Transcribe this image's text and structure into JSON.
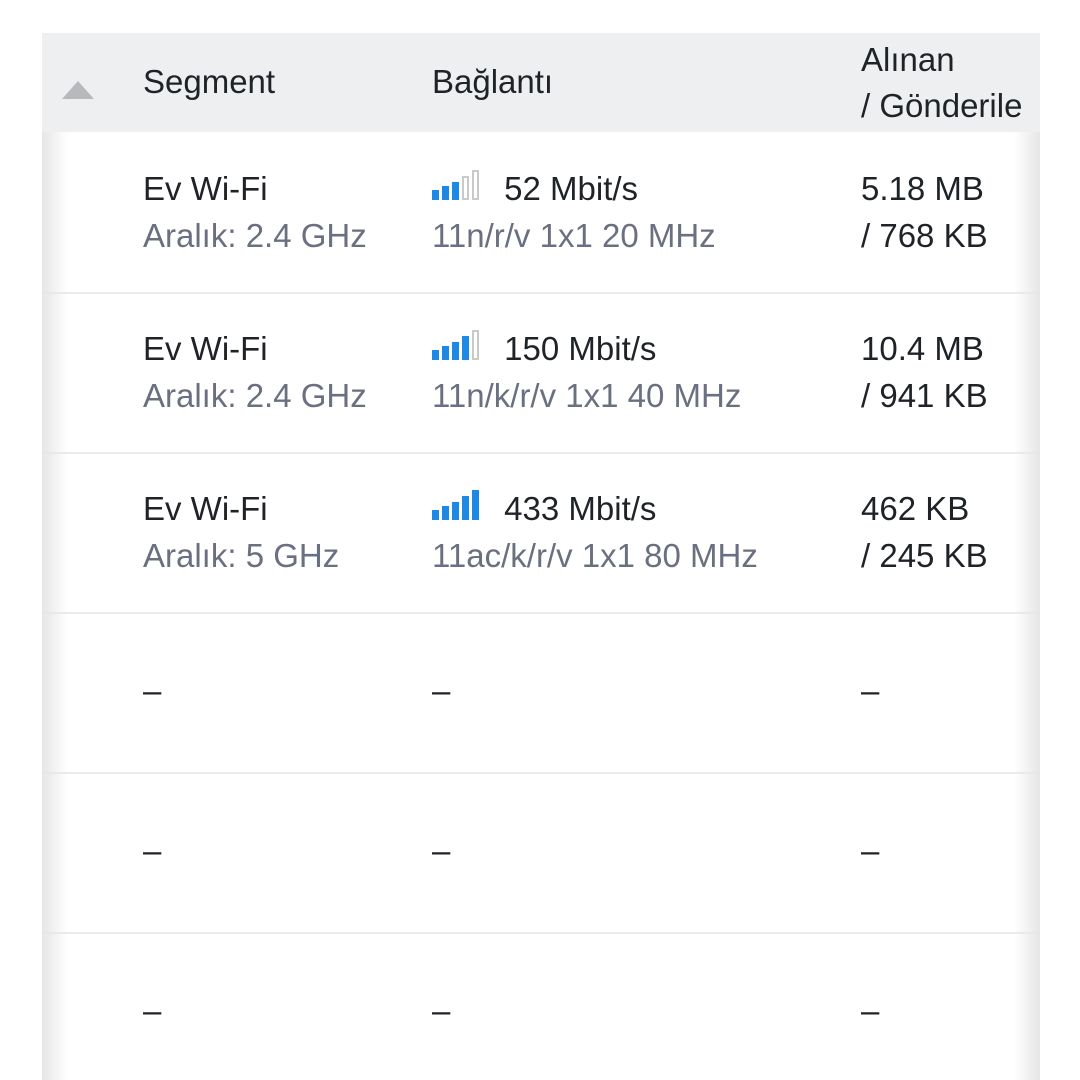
{
  "header": {
    "segment": "Segment",
    "connection": "Bağlantı",
    "received_line1": "Alınan",
    "received_line2": "/ Gönderile"
  },
  "rows": [
    {
      "segment": "Ev Wi-Fi",
      "band": "Aralık: 2.4 GHz",
      "speed": "52 Mbit/s",
      "mode": "11n/r/v 1x1 20 MHz",
      "signal_bars": 3,
      "received": "5.18 MB",
      "sent": "/ 768 KB"
    },
    {
      "segment": "Ev Wi-Fi",
      "band": "Aralık: 2.4 GHz",
      "speed": "150 Mbit/s",
      "mode": "11n/k/r/v 1x1 40 MHz",
      "signal_bars": 4,
      "received": "10.4 MB",
      "sent": "/ 941 KB"
    },
    {
      "segment": "Ev Wi-Fi",
      "band": "Aralık: 5 GHz",
      "speed": "433 Mbit/s",
      "mode": "11ac/k/r/v 1x1 80 MHz",
      "signal_bars": 5,
      "received": "462 KB",
      "sent": "/ 245 KB"
    }
  ],
  "empty_rows": [
    {
      "segment": "–",
      "connection": "–",
      "received": "–"
    },
    {
      "segment": "–",
      "connection": "–",
      "received": "–"
    },
    {
      "segment": "–",
      "connection": "–",
      "received": "–"
    }
  ],
  "colors": {
    "signal_active": "#1e88e5",
    "signal_inactive": "#c9c9c9",
    "header_bg": "#eeeff1",
    "secondary_text": "#6a7080"
  }
}
